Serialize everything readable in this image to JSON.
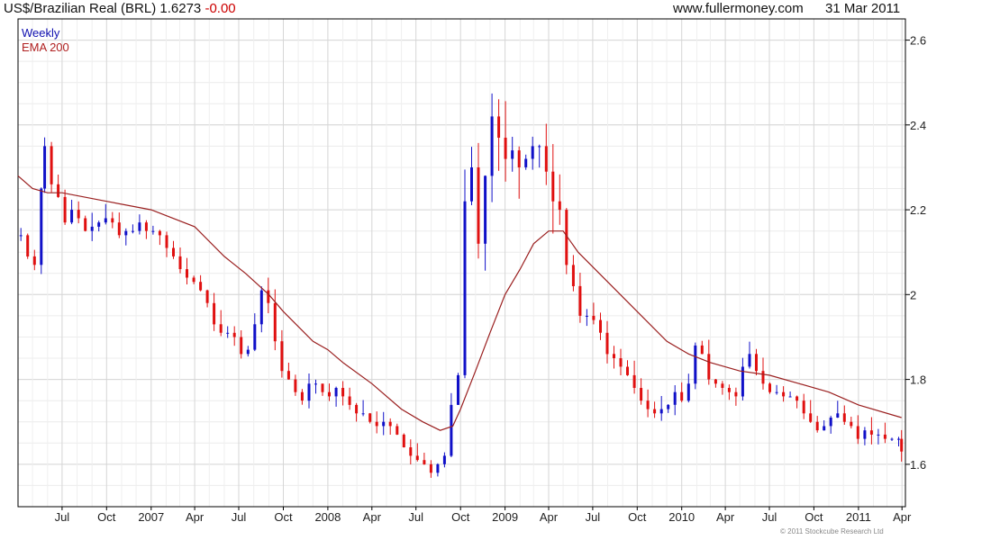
{
  "header": {
    "title": "US$/Brazilian Real (BRL) 1.6273",
    "change": "-0.00",
    "source": "www.fullermoney.com",
    "date": "31 Mar 2011"
  },
  "footer": {
    "copyright": "© 2011 Stockcube Research Ltd"
  },
  "colors": {
    "up": "#1010c8",
    "down": "#e01010",
    "ema": "#9a1f1f",
    "grid": "#d6d6d6",
    "axis": "#000000"
  },
  "chart_data": {
    "type": "candlestick-weekly",
    "legend": [
      "Weekly",
      "EMA 200"
    ],
    "legend_position": "top-left",
    "grid": true,
    "x_range": [
      "2006-04-01",
      "2011-04-08"
    ],
    "ylim": [
      1.5,
      2.65
    ],
    "y_ticks": [
      {
        "label": "1.6",
        "value": 1.6
      },
      {
        "label": "1.8",
        "value": 1.8
      },
      {
        "label": "2",
        "value": 2.0
      },
      {
        "label": "2.2",
        "value": 2.2
      },
      {
        "label": "2.4",
        "value": 2.4
      },
      {
        "label": "2.6",
        "value": 2.6
      }
    ],
    "x_ticks": [
      {
        "label": "Jul",
        "date": "2006-07-01"
      },
      {
        "label": "Oct",
        "date": "2006-10-01"
      },
      {
        "label": "2007",
        "date": "2007-01-01"
      },
      {
        "label": "Apr",
        "date": "2007-04-01"
      },
      {
        "label": "Jul",
        "date": "2007-07-01"
      },
      {
        "label": "Oct",
        "date": "2007-10-01"
      },
      {
        "label": "2008",
        "date": "2008-01-01"
      },
      {
        "label": "Apr",
        "date": "2008-04-01"
      },
      {
        "label": "Jul",
        "date": "2008-07-01"
      },
      {
        "label": "Oct",
        "date": "2008-10-01"
      },
      {
        "label": "2009",
        "date": "2009-01-01"
      },
      {
        "label": "Apr",
        "date": "2009-04-01"
      },
      {
        "label": "Jul",
        "date": "2009-07-01"
      },
      {
        "label": "Oct",
        "date": "2009-10-01"
      },
      {
        "label": "2010",
        "date": "2010-01-01"
      },
      {
        "label": "Apr",
        "date": "2010-04-01"
      },
      {
        "label": "Jul",
        "date": "2010-07-01"
      },
      {
        "label": "Oct",
        "date": "2010-10-01"
      },
      {
        "label": "2011",
        "date": "2011-01-01"
      },
      {
        "label": "Apr",
        "date": "2011-04-01"
      }
    ],
    "price_series": {
      "name": "Weekly",
      "points": [
        [
          "2006-04-07",
          2.14
        ],
        [
          "2006-04-21",
          2.09
        ],
        [
          "2006-05-05",
          2.07
        ],
        [
          "2006-05-19",
          2.25
        ],
        [
          "2006-05-26",
          2.35
        ],
        [
          "2006-06-09",
          2.26
        ],
        [
          "2006-06-23",
          2.23
        ],
        [
          "2006-07-07",
          2.17
        ],
        [
          "2006-07-21",
          2.2
        ],
        [
          "2006-08-04",
          2.18
        ],
        [
          "2006-08-18",
          2.15
        ],
        [
          "2006-09-01",
          2.16
        ],
        [
          "2006-09-15",
          2.17
        ],
        [
          "2006-09-29",
          2.18
        ],
        [
          "2006-10-13",
          2.17
        ],
        [
          "2006-10-27",
          2.14
        ],
        [
          "2006-11-10",
          2.15
        ],
        [
          "2006-11-24",
          2.15
        ],
        [
          "2006-12-08",
          2.17
        ],
        [
          "2006-12-22",
          2.15
        ],
        [
          "2007-01-05",
          2.15
        ],
        [
          "2007-01-19",
          2.14
        ],
        [
          "2007-02-02",
          2.11
        ],
        [
          "2007-02-16",
          2.09
        ],
        [
          "2007-03-02",
          2.06
        ],
        [
          "2007-03-16",
          2.04
        ],
        [
          "2007-03-30",
          2.03
        ],
        [
          "2007-04-13",
          2.01
        ],
        [
          "2007-04-27",
          1.98
        ],
        [
          "2007-05-11",
          1.93
        ],
        [
          "2007-05-25",
          1.91
        ],
        [
          "2007-06-08",
          1.91
        ],
        [
          "2007-06-22",
          1.9
        ],
        [
          "2007-07-06",
          1.86
        ],
        [
          "2007-07-20",
          1.87
        ],
        [
          "2007-08-03",
          1.93
        ],
        [
          "2007-08-17",
          2.01
        ],
        [
          "2007-08-31",
          1.98
        ],
        [
          "2007-09-14",
          1.89
        ],
        [
          "2007-09-28",
          1.82
        ],
        [
          "2007-10-12",
          1.8
        ],
        [
          "2007-10-26",
          1.77
        ],
        [
          "2007-11-09",
          1.75
        ],
        [
          "2007-11-23",
          1.79
        ],
        [
          "2007-12-07",
          1.79
        ],
        [
          "2007-12-21",
          1.77
        ],
        [
          "2008-01-04",
          1.76
        ],
        [
          "2008-01-18",
          1.78
        ],
        [
          "2008-02-01",
          1.76
        ],
        [
          "2008-02-15",
          1.74
        ],
        [
          "2008-02-29",
          1.72
        ],
        [
          "2008-03-14",
          1.72
        ],
        [
          "2008-03-28",
          1.7
        ],
        [
          "2008-04-11",
          1.69
        ],
        [
          "2008-04-25",
          1.7
        ],
        [
          "2008-05-09",
          1.69
        ],
        [
          "2008-05-23",
          1.67
        ],
        [
          "2008-06-06",
          1.64
        ],
        [
          "2008-06-20",
          1.62
        ],
        [
          "2008-07-04",
          1.61
        ],
        [
          "2008-07-18",
          1.6
        ],
        [
          "2008-08-01",
          1.58
        ],
        [
          "2008-08-15",
          1.6
        ],
        [
          "2008-08-29",
          1.62
        ],
        [
          "2008-09-12",
          1.74
        ],
        [
          "2008-09-26",
          1.81
        ],
        [
          "2008-10-10",
          2.22
        ],
        [
          "2008-10-24",
          2.3
        ],
        [
          "2008-11-07",
          2.12
        ],
        [
          "2008-11-21",
          2.28
        ],
        [
          "2008-12-05",
          2.42
        ],
        [
          "2008-12-19",
          2.37
        ],
        [
          "2009-01-02",
          2.32
        ],
        [
          "2009-01-16",
          2.34
        ],
        [
          "2009-01-30",
          2.3
        ],
        [
          "2009-02-13",
          2.32
        ],
        [
          "2009-02-27",
          2.35
        ],
        [
          "2009-03-13",
          2.35
        ],
        [
          "2009-03-27",
          2.29
        ],
        [
          "2009-04-10",
          2.22
        ],
        [
          "2009-04-24",
          2.2
        ],
        [
          "2009-05-08",
          2.07
        ],
        [
          "2009-05-22",
          2.02
        ],
        [
          "2009-06-05",
          1.95
        ],
        [
          "2009-06-19",
          1.95
        ],
        [
          "2009-07-03",
          1.94
        ],
        [
          "2009-07-17",
          1.91
        ],
        [
          "2009-07-31",
          1.86
        ],
        [
          "2009-08-14",
          1.85
        ],
        [
          "2009-08-28",
          1.83
        ],
        [
          "2009-09-11",
          1.81
        ],
        [
          "2009-09-25",
          1.78
        ],
        [
          "2009-10-09",
          1.75
        ],
        [
          "2009-10-23",
          1.73
        ],
        [
          "2009-11-06",
          1.72
        ],
        [
          "2009-11-20",
          1.73
        ],
        [
          "2009-12-04",
          1.74
        ],
        [
          "2009-12-18",
          1.77
        ],
        [
          "2010-01-01",
          1.75
        ],
        [
          "2010-01-15",
          1.79
        ],
        [
          "2010-01-29",
          1.88
        ],
        [
          "2010-02-12",
          1.86
        ],
        [
          "2010-02-26",
          1.8
        ],
        [
          "2010-03-12",
          1.79
        ],
        [
          "2010-03-26",
          1.78
        ],
        [
          "2010-04-09",
          1.77
        ],
        [
          "2010-04-23",
          1.76
        ],
        [
          "2010-05-07",
          1.83
        ],
        [
          "2010-05-21",
          1.86
        ],
        [
          "2010-06-04",
          1.82
        ],
        [
          "2010-06-18",
          1.79
        ],
        [
          "2010-07-02",
          1.77
        ],
        [
          "2010-07-16",
          1.77
        ],
        [
          "2010-07-30",
          1.76
        ],
        [
          "2010-08-13",
          1.76
        ],
        [
          "2010-08-27",
          1.75
        ],
        [
          "2010-09-10",
          1.72
        ],
        [
          "2010-09-24",
          1.7
        ],
        [
          "2010-10-08",
          1.68
        ],
        [
          "2010-10-22",
          1.69
        ],
        [
          "2010-11-05",
          1.71
        ],
        [
          "2010-11-19",
          1.72
        ],
        [
          "2010-12-03",
          1.7
        ],
        [
          "2010-12-17",
          1.69
        ],
        [
          "2010-12-31",
          1.66
        ],
        [
          "2011-01-14",
          1.68
        ],
        [
          "2011-01-28",
          1.67
        ],
        [
          "2011-02-11",
          1.67
        ],
        [
          "2011-02-25",
          1.66
        ],
        [
          "2011-03-11",
          1.66
        ],
        [
          "2011-03-25",
          1.66
        ],
        [
          "2011-03-31",
          1.63
        ]
      ]
    },
    "ema_series": {
      "name": "EMA 200",
      "points": [
        [
          "2006-04-01",
          2.28
        ],
        [
          "2006-05-01",
          2.25
        ],
        [
          "2006-06-01",
          2.24
        ],
        [
          "2006-07-01",
          2.24
        ],
        [
          "2006-10-01",
          2.22
        ],
        [
          "2007-01-01",
          2.2
        ],
        [
          "2007-04-01",
          2.16
        ],
        [
          "2007-06-01",
          2.09
        ],
        [
          "2007-07-15",
          2.05
        ],
        [
          "2007-09-01",
          2.0
        ],
        [
          "2007-10-01",
          1.96
        ],
        [
          "2007-12-01",
          1.89
        ],
        [
          "2008-01-01",
          1.87
        ],
        [
          "2008-02-01",
          1.84
        ],
        [
          "2008-04-01",
          1.79
        ],
        [
          "2008-06-01",
          1.73
        ],
        [
          "2008-07-15",
          1.7
        ],
        [
          "2008-08-20",
          1.68
        ],
        [
          "2008-09-15",
          1.69
        ],
        [
          "2008-10-01",
          1.73
        ],
        [
          "2008-11-01",
          1.82
        ],
        [
          "2008-12-01",
          1.91
        ],
        [
          "2009-01-01",
          2.0
        ],
        [
          "2009-02-01",
          2.06
        ],
        [
          "2009-03-01",
          2.12
        ],
        [
          "2009-04-01",
          2.15
        ],
        [
          "2009-05-01",
          2.15
        ],
        [
          "2009-06-01",
          2.1
        ],
        [
          "2009-08-01",
          2.03
        ],
        [
          "2009-10-01",
          1.96
        ],
        [
          "2009-12-01",
          1.89
        ],
        [
          "2010-01-15",
          1.86
        ],
        [
          "2010-03-01",
          1.84
        ],
        [
          "2010-05-01",
          1.82
        ],
        [
          "2010-07-01",
          1.81
        ],
        [
          "2010-09-01",
          1.79
        ],
        [
          "2010-11-01",
          1.77
        ],
        [
          "2011-01-01",
          1.74
        ],
        [
          "2011-03-31",
          1.71
        ]
      ]
    }
  }
}
